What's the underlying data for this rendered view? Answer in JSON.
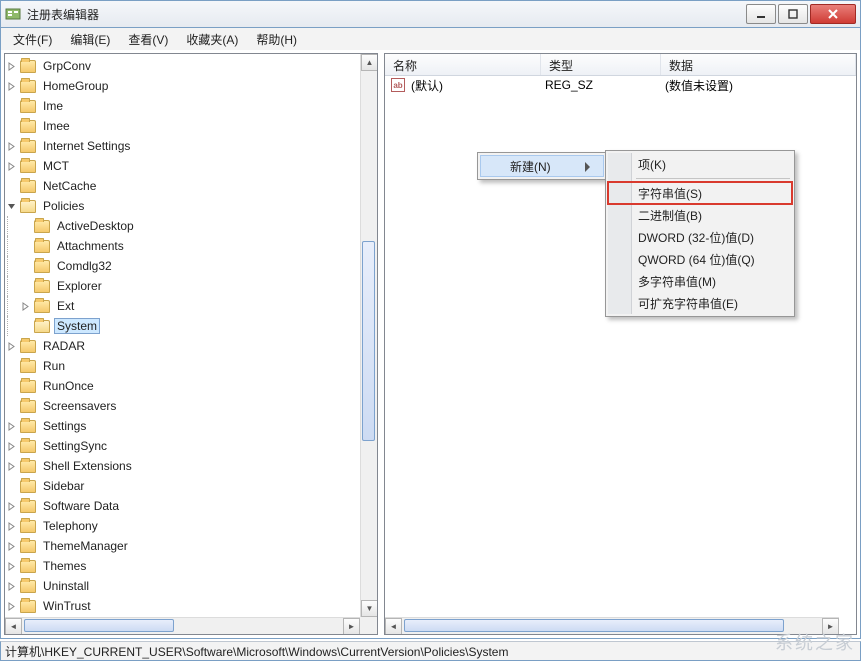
{
  "window": {
    "title": "注册表编辑器"
  },
  "menu": {
    "file": "文件(F)",
    "edit": "编辑(E)",
    "view": "查看(V)",
    "favorites": "收藏夹(A)",
    "help": "帮助(H)"
  },
  "tree": {
    "items": [
      {
        "depth": 7,
        "expander": "closed",
        "label": "GrpConv"
      },
      {
        "depth": 7,
        "expander": "closed",
        "label": "HomeGroup"
      },
      {
        "depth": 7,
        "expander": "none",
        "label": "Ime"
      },
      {
        "depth": 7,
        "expander": "none",
        "label": "Imee"
      },
      {
        "depth": 7,
        "expander": "closed",
        "label": "Internet Settings"
      },
      {
        "depth": 7,
        "expander": "closed",
        "label": "MCT"
      },
      {
        "depth": 7,
        "expander": "none",
        "label": "NetCache"
      },
      {
        "depth": 7,
        "expander": "open",
        "label": "Policies",
        "open": true
      },
      {
        "depth": 8,
        "expander": "none",
        "label": "ActiveDesktop"
      },
      {
        "depth": 8,
        "expander": "none",
        "label": "Attachments"
      },
      {
        "depth": 8,
        "expander": "none",
        "label": "Comdlg32"
      },
      {
        "depth": 8,
        "expander": "none",
        "label": "Explorer"
      },
      {
        "depth": 8,
        "expander": "closed",
        "label": "Ext"
      },
      {
        "depth": 8,
        "expander": "none",
        "label": "System",
        "selected": true,
        "open": true
      },
      {
        "depth": 7,
        "expander": "closed",
        "label": "RADAR"
      },
      {
        "depth": 7,
        "expander": "none",
        "label": "Run"
      },
      {
        "depth": 7,
        "expander": "none",
        "label": "RunOnce"
      },
      {
        "depth": 7,
        "expander": "none",
        "label": "Screensavers"
      },
      {
        "depth": 7,
        "expander": "closed",
        "label": "Settings"
      },
      {
        "depth": 7,
        "expander": "closed",
        "label": "SettingSync"
      },
      {
        "depth": 7,
        "expander": "closed",
        "label": "Shell Extensions"
      },
      {
        "depth": 7,
        "expander": "none",
        "label": "Sidebar"
      },
      {
        "depth": 7,
        "expander": "closed",
        "label": "Software Data"
      },
      {
        "depth": 7,
        "expander": "closed",
        "label": "Telephony"
      },
      {
        "depth": 7,
        "expander": "closed",
        "label": "ThemeManager"
      },
      {
        "depth": 7,
        "expander": "closed",
        "label": "Themes"
      },
      {
        "depth": 7,
        "expander": "closed",
        "label": "Uninstall"
      },
      {
        "depth": 7,
        "expander": "closed",
        "label": "WinTrust"
      }
    ]
  },
  "list": {
    "columns": {
      "name": "名称",
      "type": "类型",
      "data": "数据"
    },
    "rows": [
      {
        "icon": "ab",
        "name": "(默认)",
        "type": "REG_SZ",
        "data": "(数值未设置)"
      }
    ]
  },
  "context": {
    "parent": {
      "new": "新建(N)"
    },
    "sub": {
      "key": "项(K)",
      "string": "字符串值(S)",
      "binary": "二进制值(B)",
      "dword": "DWORD (32-位)值(D)",
      "qword": "QWORD (64 位)值(Q)",
      "multi": "多字符串值(M)",
      "expand": "可扩充字符串值(E)"
    }
  },
  "statusbar": {
    "path": "计算机\\HKEY_CURRENT_USER\\Software\\Microsoft\\Windows\\CurrentVersion\\Policies\\System"
  },
  "watermark": "系统之家"
}
